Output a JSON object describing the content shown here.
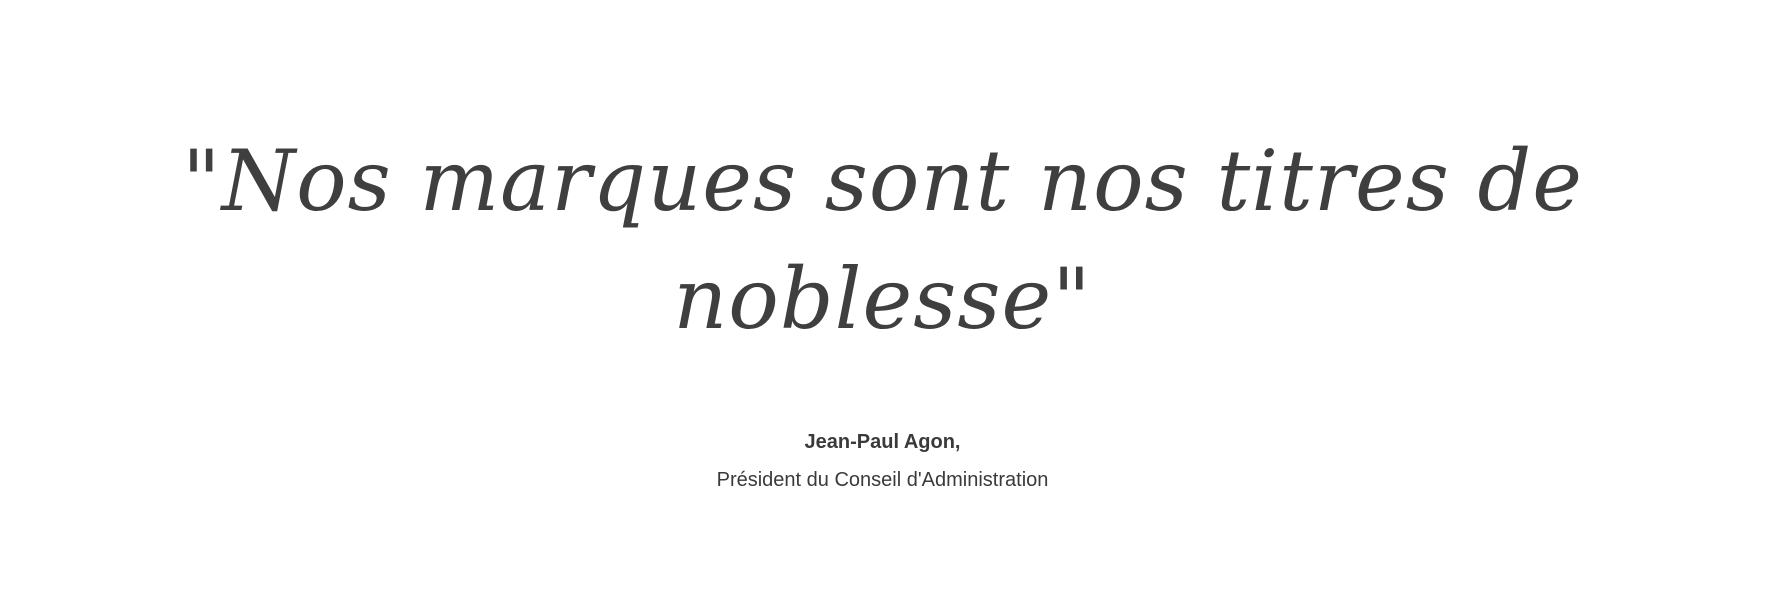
{
  "quote": {
    "line1": "\"Nos marques sont nos titres de",
    "line2": "noblesse\""
  },
  "attribution": {
    "name": "Jean-Paul Agon,",
    "title": "Président du Conseil d'Administration"
  },
  "colors": {
    "text": "#3f3f3f",
    "background": "#ffffff"
  }
}
